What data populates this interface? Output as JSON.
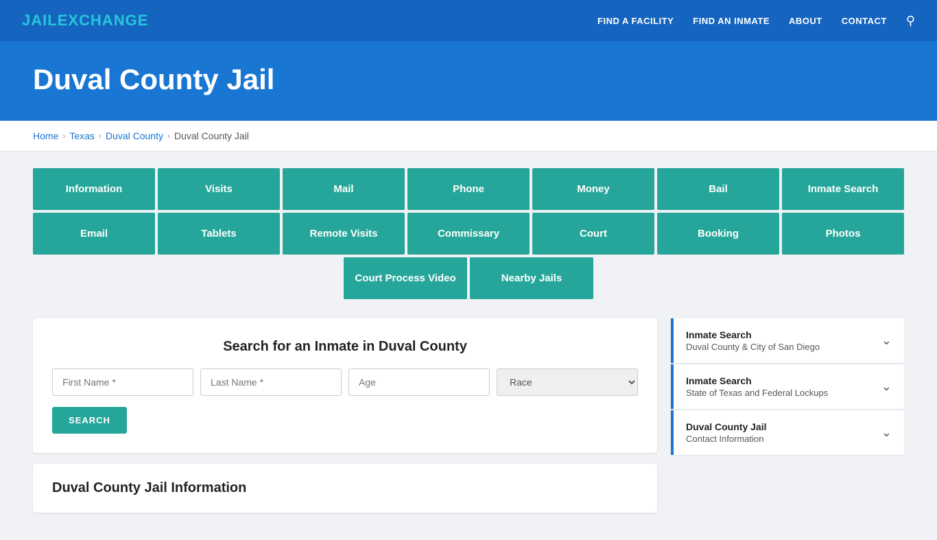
{
  "brand": {
    "name_part1": "JAIL",
    "name_part2": "EXCHANGE"
  },
  "nav": {
    "links": [
      {
        "label": "FIND A FACILITY",
        "href": "#"
      },
      {
        "label": "FIND AN INMATE",
        "href": "#"
      },
      {
        "label": "ABOUT",
        "href": "#"
      },
      {
        "label": "CONTACT",
        "href": "#"
      }
    ]
  },
  "hero": {
    "title": "Duval County Jail"
  },
  "breadcrumb": {
    "items": [
      {
        "label": "Home",
        "href": "#"
      },
      {
        "label": "Texas",
        "href": "#"
      },
      {
        "label": "Duval County",
        "href": "#"
      },
      {
        "label": "Duval County Jail",
        "href": "#"
      }
    ]
  },
  "tabs_row1": [
    {
      "label": "Information"
    },
    {
      "label": "Visits"
    },
    {
      "label": "Mail"
    },
    {
      "label": "Phone"
    },
    {
      "label": "Money"
    },
    {
      "label": "Bail"
    },
    {
      "label": "Inmate Search"
    }
  ],
  "tabs_row2": [
    {
      "label": "Email"
    },
    {
      "label": "Tablets"
    },
    {
      "label": "Remote Visits"
    },
    {
      "label": "Commissary"
    },
    {
      "label": "Court"
    },
    {
      "label": "Booking"
    },
    {
      "label": "Photos"
    }
  ],
  "tabs_row3": [
    {
      "label": "Court Process Video"
    },
    {
      "label": "Nearby Jails"
    }
  ],
  "search": {
    "title": "Search for an Inmate in Duval County",
    "first_name_placeholder": "First Name *",
    "last_name_placeholder": "Last Name *",
    "age_placeholder": "Age",
    "race_placeholder": "Race",
    "button_label": "SEARCH"
  },
  "info_section": {
    "title": "Duval County Jail Information"
  },
  "sidebar": {
    "items": [
      {
        "title": "Inmate Search",
        "subtitle": "Duval County & City of San Diego"
      },
      {
        "title": "Inmate Search",
        "subtitle": "State of Texas and Federal Lockups"
      },
      {
        "title": "Duval County Jail",
        "subtitle": "Contact Information"
      }
    ]
  }
}
